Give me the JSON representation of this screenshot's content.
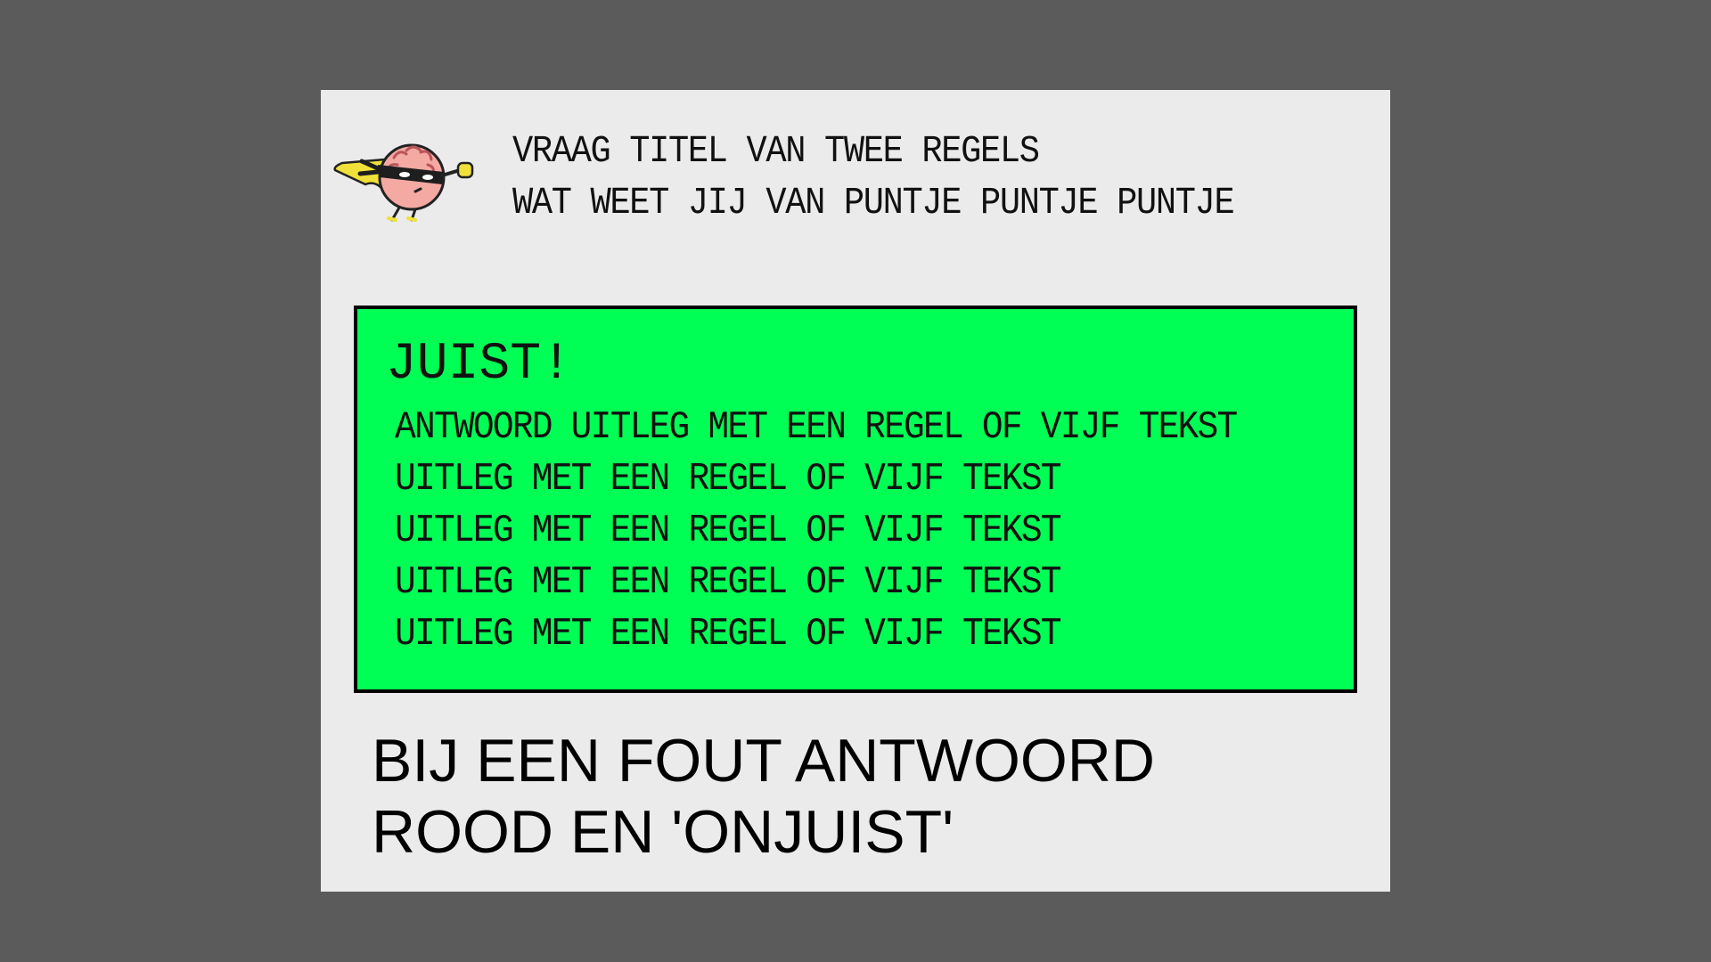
{
  "header": {
    "logo_icon": "masked-superhero-brain-icon",
    "title_lines": [
      "VRAAG TITEL VAN TWEE REGELS",
      "WAT WEET JIJ VAN PUNTJE PUNTJE PUNTJE"
    ]
  },
  "feedback": {
    "background_color": "#00ff55",
    "heading": "JUIST!",
    "lines": [
      "ANTWOORD UITLEG MET EEN REGEL OF VIJF TEKST",
      "UITLEG MET EEN REGEL OF VIJF TEKST",
      "UITLEG MET EEN REGEL OF VIJF TEKST",
      "UITLEG MET EEN REGEL OF VIJF TEKST",
      "UITLEG MET EEN REGEL OF VIJF TEKST"
    ]
  },
  "note": {
    "lines": [
      "BIJ EEN FOUT ANTWOORD",
      "ROOD EN 'ONJUIST'"
    ]
  },
  "colors": {
    "page_background": "#5b5b5b",
    "slide_background": "#ebebeb",
    "correct_green": "#00ff55"
  }
}
